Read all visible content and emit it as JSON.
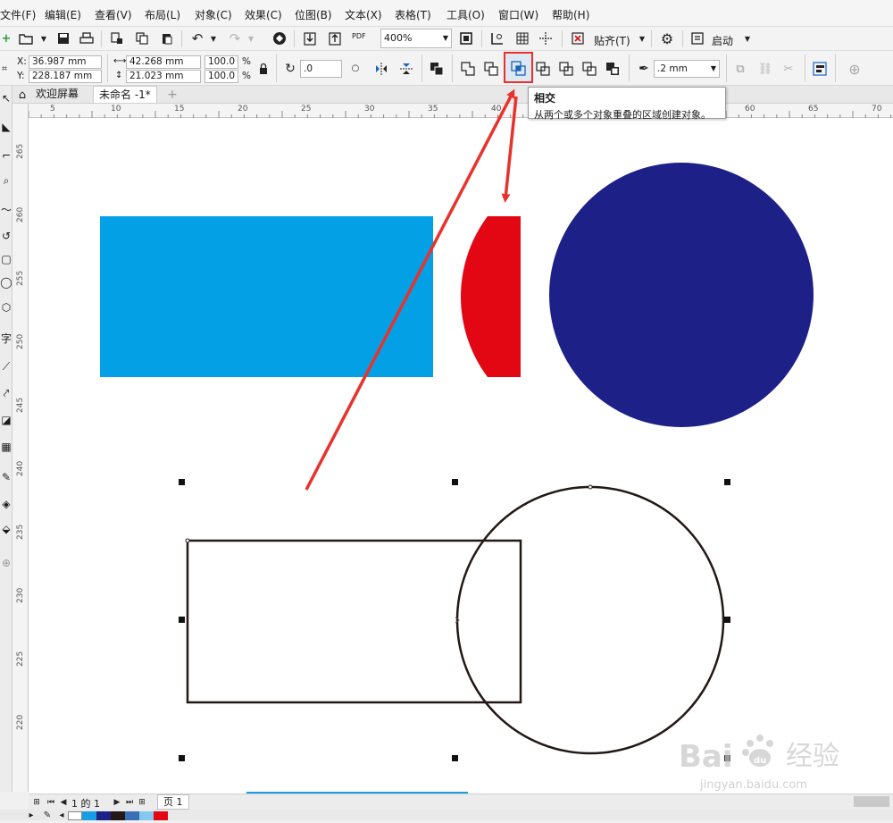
{
  "menubar": {
    "items": [
      "文件(F)",
      "编辑(E)",
      "查看(V)",
      "布局(L)",
      "对象(C)",
      "效果(C)",
      "位图(B)",
      "文本(X)",
      "表格(T)",
      "工具(O)",
      "窗口(W)",
      "帮助(H)"
    ]
  },
  "toolbar": {
    "pdf_label": "PDF",
    "zoom_value": "400%",
    "snap_label": "贴齐(T)",
    "launch_label": "启动"
  },
  "property_bar": {
    "x_label": "X:",
    "x_value": "36.987 mm",
    "y_label": "Y:",
    "y_value": "228.187 mm",
    "width_value": "42.268 mm",
    "height_value": "21.023 mm",
    "scale_x": "100.0",
    "scale_y": "100.0",
    "percent": "%",
    "rotation_value": ".0",
    "outline_width": ".2 mm"
  },
  "tabs": {
    "welcome": "欢迎屏幕",
    "document": "未命名 -1*"
  },
  "ruler": {
    "top_labels": [
      "5",
      "10",
      "15",
      "20",
      "25",
      "30",
      "35",
      "40",
      "45",
      "50",
      "55",
      "60",
      "65",
      "70"
    ],
    "left_labels": [
      "265",
      "260",
      "255",
      "250",
      "245",
      "240",
      "235",
      "230",
      "225",
      "220"
    ]
  },
  "tooltip": {
    "title": "相交",
    "description": "从两个或多个对象重叠的区域创建对象。"
  },
  "pagebar": {
    "page_count": "1 的 1",
    "page_tab": "页 1"
  },
  "colors": {
    "blue_rect": "#04a0e6",
    "red_shape": "#e30613",
    "navy_circle": "#1d2087",
    "annotation_red": "#e8322c"
  },
  "palette": [
    "#ffffff",
    "#1a9de0",
    "#1d2087",
    "#231815",
    "#3a6fb5",
    "#84c8ef",
    "#e30613"
  ],
  "watermark": {
    "brand": "Bai",
    "paw": "du",
    "product": "经验",
    "url": "jingyan.baidu.com"
  }
}
